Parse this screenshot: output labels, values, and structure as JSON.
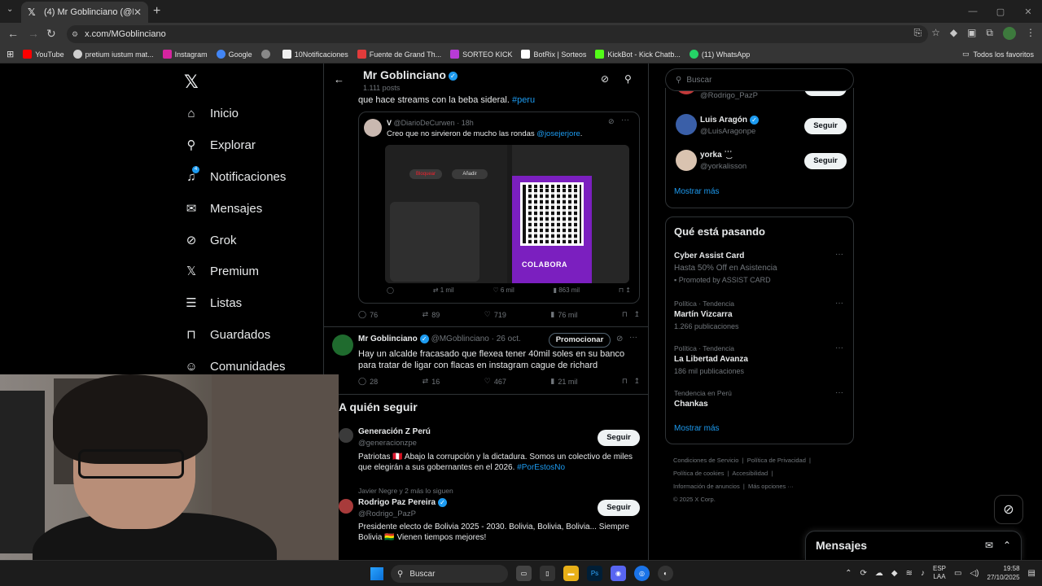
{
  "browser": {
    "tab_title": "(4) Mr Goblinciano (@MGoblinc",
    "url": "x.com/MGoblinciano",
    "bookmarks": [
      {
        "label": "YouTube",
        "color": "#ff0000"
      },
      {
        "label": "pretium iustum mat...",
        "color": "#cfcfcf"
      },
      {
        "label": "Instagram",
        "color": "#d6249f"
      },
      {
        "label": "Google",
        "color": "#4285f4"
      },
      {
        "label": "",
        "color": "#888888"
      },
      {
        "label": "10Notificaciones",
        "color": "#f0f0f0"
      },
      {
        "label": "Fuente de Grand Th...",
        "color": "#e23b3b"
      },
      {
        "label": "SORTEO KICK",
        "color": "#b73bd6"
      },
      {
        "label": "BotRix | Sorteos",
        "color": "#ffffff"
      },
      {
        "label": "KickBot - Kick Chatb...",
        "color": "#53fc18"
      },
      {
        "label": "(11) WhatsApp",
        "color": "#25d366"
      }
    ],
    "all_bookmarks": "Todos los favoritos"
  },
  "nav": {
    "items": [
      {
        "label": "Inicio",
        "icon": "home-icon"
      },
      {
        "label": "Explorar",
        "icon": "search-icon"
      },
      {
        "label": "Notificaciones",
        "icon": "bell-icon",
        "badge": "4"
      },
      {
        "label": "Mensajes",
        "icon": "envelope-icon"
      },
      {
        "label": "Grok",
        "icon": "grok-icon"
      },
      {
        "label": "Premium",
        "icon": "x-icon"
      },
      {
        "label": "Listas",
        "icon": "list-icon"
      },
      {
        "label": "Guardados",
        "icon": "bookmark-icon"
      },
      {
        "label": "Comunidades",
        "icon": "people-icon"
      }
    ]
  },
  "profile_header": {
    "name": "Mr Goblinciano",
    "posts": "1.111 posts"
  },
  "tweet1": {
    "text_plain": "que hace streams con la beba sideral. ",
    "hashtag": "#peru",
    "quote": {
      "name": "V",
      "handle": "@DiarioDeCurwen",
      "time": "· 18h",
      "text": "Creo que no sirvieron de mucho las rondas ",
      "mention": "@josejerjore",
      "text_end": ".",
      "colabora": "COLABORA",
      "block": "Bloquear",
      "add": "Añadir",
      "stats": {
        "retweets": "1 mil",
        "likes": "6 mil",
        "views": "863 mil"
      }
    },
    "stats": {
      "replies": "76",
      "retweets": "89",
      "likes": "719",
      "views": "76 mil"
    }
  },
  "tweet2": {
    "name": "Mr Goblinciano",
    "handle": "@MGoblinciano",
    "time": "· 26 oct.",
    "promote": "Promocionar",
    "text": "Hay un alcalde fracasado que flexea tener 40mil soles en su banco para tratar de ligar con flacas en instagram cague de richard",
    "stats": {
      "replies": "28",
      "retweets": "16",
      "likes": "467",
      "views": "21 mil"
    }
  },
  "who_to_follow": {
    "title": "A quién seguir",
    "follow_label": "Seguir",
    "items": [
      {
        "name": "Generación Z Perú",
        "handle": "@generacionzpe",
        "bio": "Patriotas 🇵🇪 Abajo la corrupción y la dictadura. Somos un colectivo de miles que elegirán a sus gobernantes en el 2026. ",
        "bio_tag": "#PorEstosNo",
        "context": ""
      },
      {
        "name": "Rodrigo Paz Pereira",
        "handle": "@Rodrigo_PazP",
        "bio": "Presidente electo de Bolivia 2025 - 2030. Bolivia, Bolivia, Bolivia... Siempre Bolivia 🇧🇴 Vienen tiempos mejores!",
        "bio_tag": "",
        "context": "Javier Negre y 2 más lo siguen"
      }
    ]
  },
  "right": {
    "search_placeholder": "Buscar",
    "who": [
      {
        "name": "",
        "handle": "@Rodrigo_PazP",
        "color": "#c23a3a"
      },
      {
        "name": "Luis Aragón",
        "handle": "@LuisAragonpe",
        "color": "#3a5fa8"
      },
      {
        "name": "yorka ʾ͜ʾʾ",
        "handle": "@yorkalisson",
        "color": "#d9c3b0"
      }
    ],
    "follow_label": "Seguir",
    "show_more": "Mostrar más",
    "trends_title": "Qué está pasando",
    "trends": [
      {
        "context": "",
        "name": "Cyber Assist Card",
        "sub": "Hasta 50% Off en Asistencia",
        "promoted": "Promoted by ASSIST CARD"
      },
      {
        "context": "Política · Tendencia",
        "name": "Martín Vizcarra",
        "sub": "1.266 publicaciones",
        "promoted": ""
      },
      {
        "context": "Política · Tendencia",
        "name": "La Libertad Avanza",
        "sub": "186 mil publicaciones",
        "promoted": ""
      },
      {
        "context": "Tendencia en Perú",
        "name": "Chankas",
        "sub": "",
        "promoted": ""
      }
    ],
    "trends_more": "Mostrar más",
    "footer": [
      "Condiciones de Servicio",
      "Política de Privacidad",
      "Política de cookies",
      "Accesibilidad",
      "Información de anuncios",
      "Más opciones ···",
      "© 2025 X Corp."
    ]
  },
  "messages_drawer": {
    "title": "Mensajes"
  },
  "taskbar": {
    "search": "Buscar",
    "lang": "ESP",
    "lang2": "LAA",
    "time": "19:58",
    "date": "27/10/2025"
  }
}
